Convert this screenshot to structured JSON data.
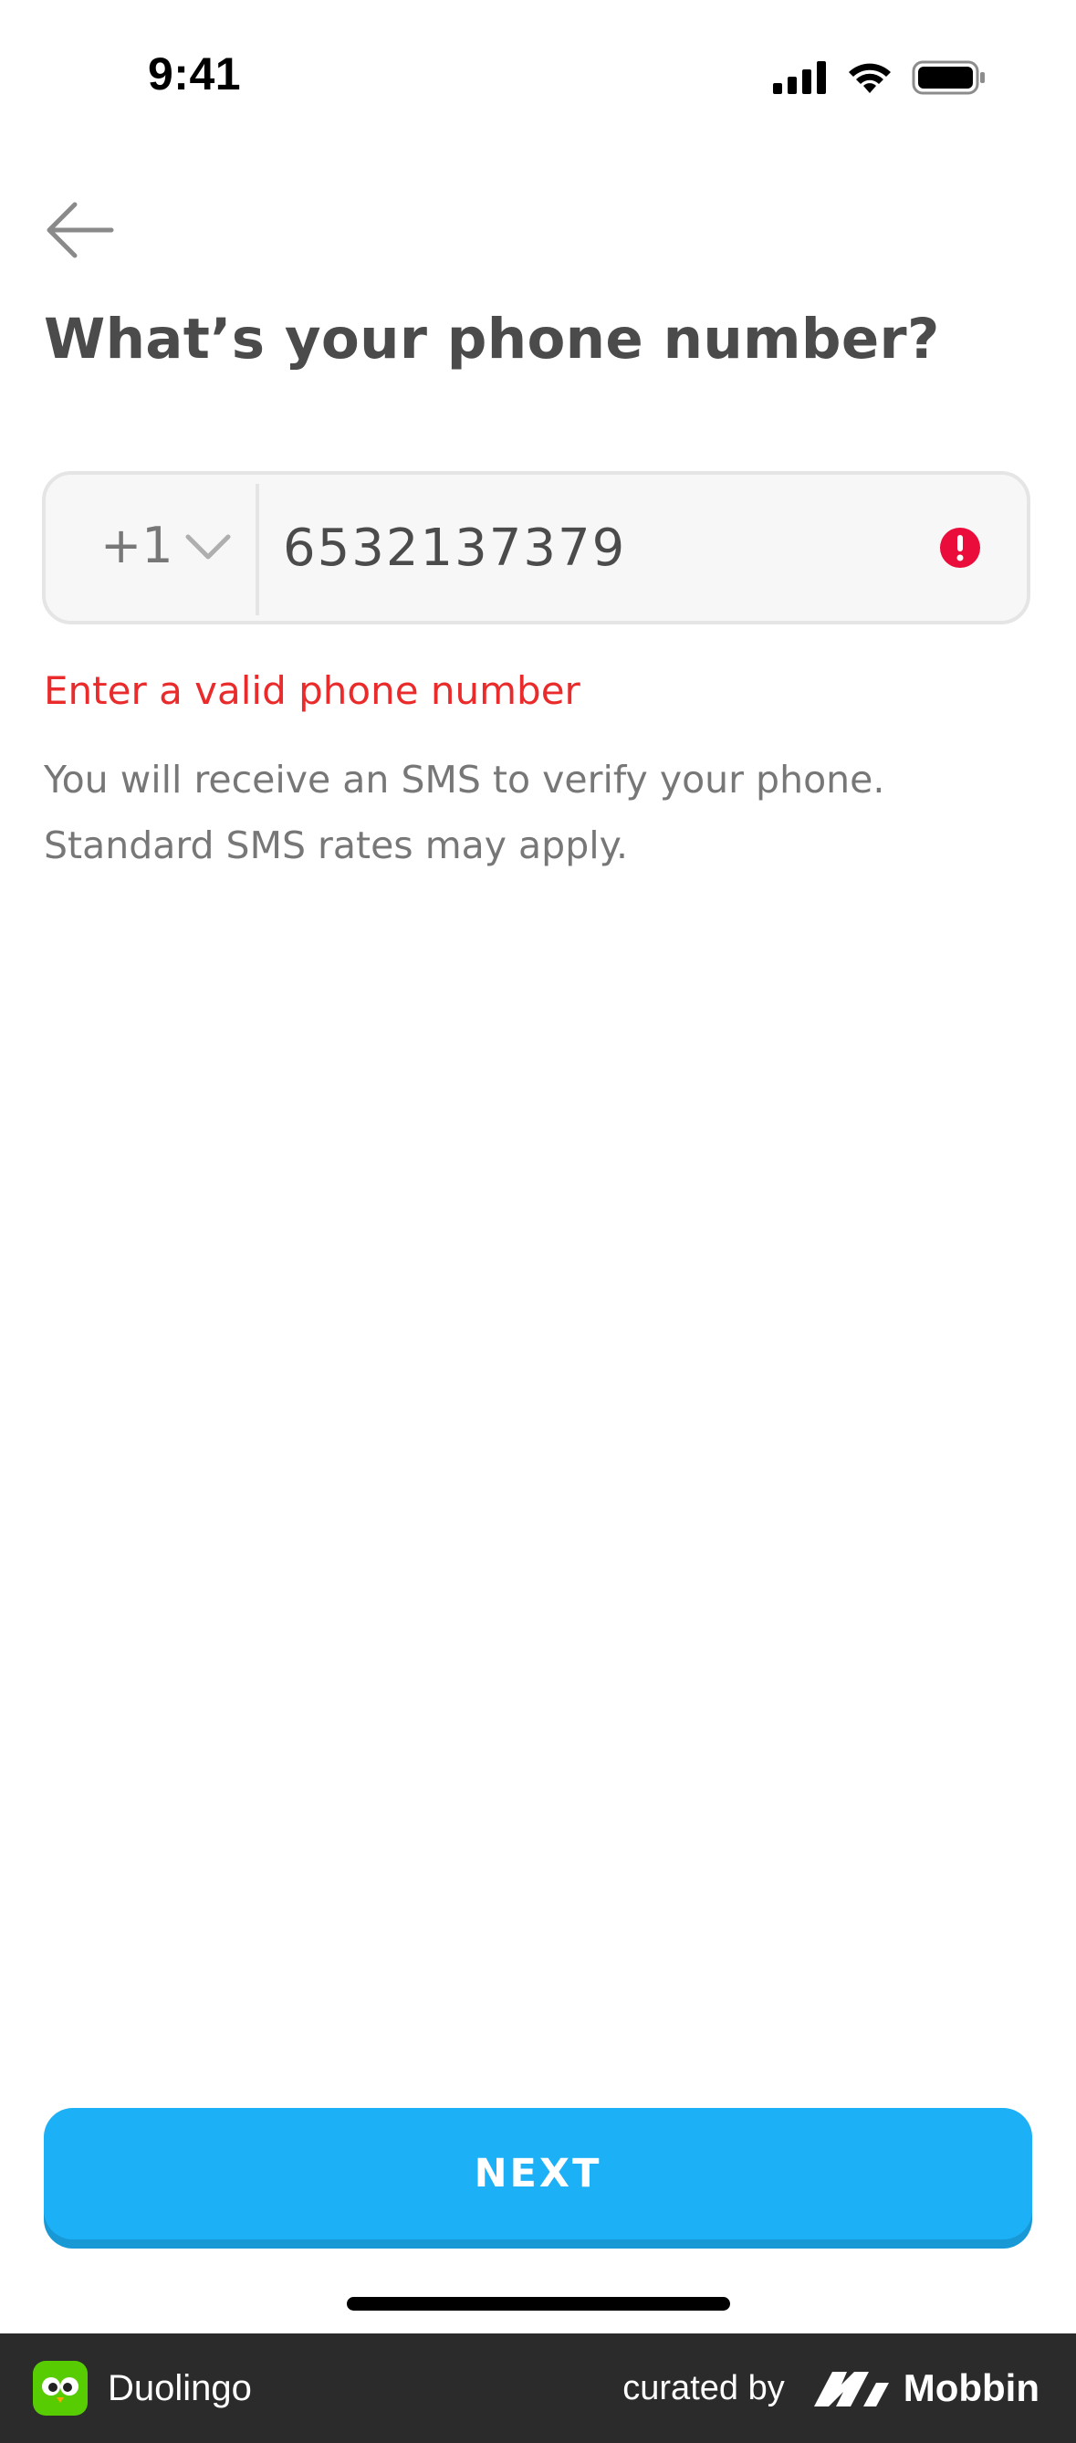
{
  "status_bar": {
    "time": "9:41",
    "icons": [
      "cellular-signal-icon",
      "wifi-icon",
      "battery-icon"
    ]
  },
  "nav": {
    "back_icon": "arrow-left-icon"
  },
  "page": {
    "title": "What’s your phone number?"
  },
  "phone_field": {
    "country_code": "+1",
    "number": "6532137379",
    "dropdown_icon": "chevron-down-icon",
    "status_icon": "error-alert-icon"
  },
  "error": {
    "message": "Enter a valid phone number"
  },
  "helper": {
    "text": "You will receive an SMS to verify your phone. Standard SMS rates may apply."
  },
  "actions": {
    "next_label": "NEXT"
  },
  "footer": {
    "app_name": "Duolingo",
    "curated_label": "curated by",
    "brand": "Mobbin"
  },
  "colors": {
    "primary": "#1cb0f6",
    "primary_shadow": "#1899d6",
    "error": "#ea2b2b",
    "text": "#4b4b4b",
    "muted": "#777777",
    "field_bg": "#f7f7f7",
    "field_border": "#e5e5e5",
    "footer_bg": "#2b2b2b",
    "duolingo_green": "#58cc02"
  }
}
